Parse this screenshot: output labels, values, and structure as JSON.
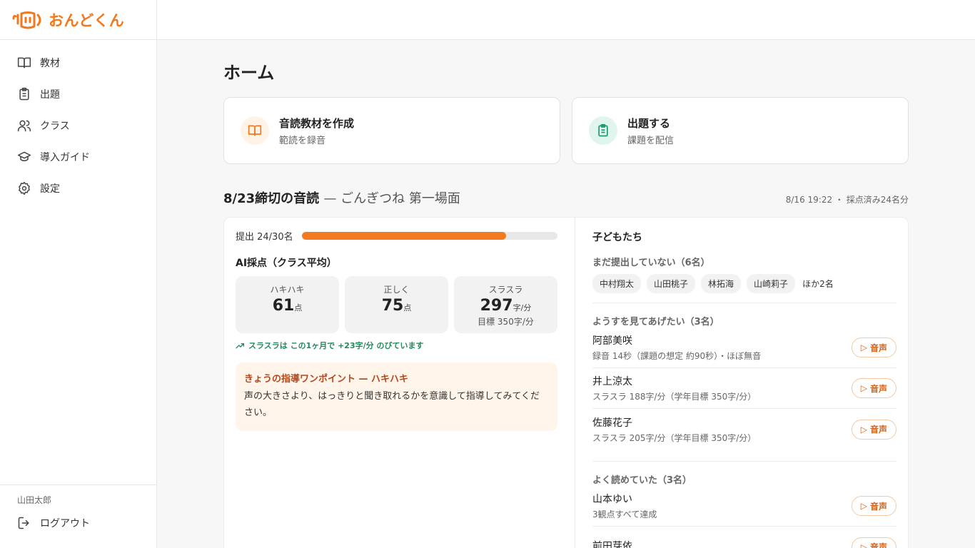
{
  "app": {
    "logo_text": "おんどくん"
  },
  "sidebar": {
    "items": [
      {
        "label": "教材",
        "icon": "book-icon"
      },
      {
        "label": "出題",
        "icon": "clipboard-icon"
      },
      {
        "label": "クラス",
        "icon": "users-icon"
      },
      {
        "label": "導入ガイド",
        "icon": "graduation-cap-icon"
      },
      {
        "label": "設定",
        "icon": "gear-icon"
      }
    ],
    "user_name": "山田太郎",
    "logout_label": "ログアウト"
  },
  "page": {
    "title": "ホーム"
  },
  "actions": [
    {
      "title": "音読教材を作成",
      "subtitle": "範読を録音",
      "icon": "book-icon",
      "color": "#f0791f"
    },
    {
      "title": "出題する",
      "subtitle": "課題を配信",
      "icon": "clipboard-icon",
      "color": "#1f9a6c"
    }
  ],
  "assignment": {
    "title": "8/23締切の音読",
    "subtitle": "— ごんぎつね 第一場面",
    "meta": "8/16 19:22 ・ 採点済み24名分",
    "progress_label": "提出 24/30名",
    "submitted": 24,
    "total": 30,
    "ai_title": "AI採点（クラス平均）",
    "scores": [
      {
        "label": "ハキハキ",
        "value": "61",
        "unit": "点",
        "target": ""
      },
      {
        "label": "正しく",
        "value": "75",
        "unit": "点",
        "target": ""
      },
      {
        "label": "スラスラ",
        "value": "297",
        "unit": "字/分",
        "target": "目標 350字/分"
      }
    ],
    "trend": "スラスラは この1ヶ月で +23字/分 のびています",
    "tip_title": "きょうの指導ワンポイント — ハキハキ",
    "tip_body": "声の大きさより、はっきりと聞き取れるかを意識して指導してみてください。"
  },
  "kids": {
    "title": "子どもたち",
    "not_submitted": {
      "title": "まだ提出していない（6名）",
      "names": [
        "中村翔太",
        "山田桃子",
        "林拓海",
        "山崎莉子"
      ],
      "more": "ほか2名"
    },
    "watch": {
      "title": "ようすを見てあげたい（3名）",
      "rows": [
        {
          "name": "阿部美咲",
          "detail": "録音 14秒（課題の想定 約90秒）・ほぼ無音"
        },
        {
          "name": "井上涼太",
          "detail": "スラスラ 188字/分（学年目標 350字/分）"
        },
        {
          "name": "佐藤花子",
          "detail": "スラスラ 205字/分（学年目標 350字/分）"
        }
      ]
    },
    "good": {
      "title": "よく読めていた（3名）",
      "rows": [
        {
          "name": "山本ゆい",
          "detail": "3観点すべて達成"
        },
        {
          "name": "前田芽依",
          "detail": ""
        }
      ]
    },
    "audio_label": "音声"
  }
}
